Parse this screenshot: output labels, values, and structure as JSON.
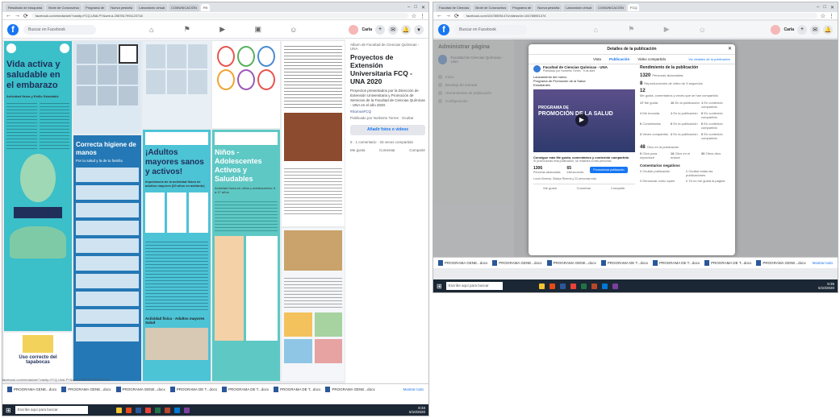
{
  "left": {
    "tabs": [
      "Resultado de búsqueda",
      "Brote de Coronavirus",
      "Programa de",
      "Nueva pestaña",
      "Laboratorio virtual",
      "COMUNICACIÓN",
      "FB"
    ],
    "url": "facebook.com/media/set/?vanity=FCQ.UNA.PY&set=a.2557817991123718",
    "fb": {
      "search_placeholder": "Buscar en Facebook",
      "user": "Carla"
    },
    "posters": {
      "p1_title": "Vida activa y saludable en el embarazo",
      "p1_sub": "Actividad física y Estilo Saludable",
      "p2_title": "Correcta higiene de manos",
      "p2_sub": "Por tu salud y la de tu familia",
      "p3_title": "¡Adultos mayores sanos y activos!",
      "p3_sub": "Importancia de la actividad física en adultos mayores (60 años en adelante)",
      "p4_title": "Niños - Adolescentes Activos y Saludables",
      "p4_sub": "Actividad física en niños y adolescentes: 5 a 17 años",
      "p3_foot": "Actividad física · Adultos mayores Salud",
      "p6_title": "Uso correcto del tapabocas"
    },
    "album": {
      "author": "Album de Facultad de Ciencias Químicas - UNA",
      "title": "Proyectos de Extensión Universitaria FCQ - UNA 2020",
      "desc": "Proyectos presentados por la Dirección de Extensión Universitaria y Promoción de Servicios de la Facultad de Ciencias Químicas - UNA en el año 2020.",
      "tag": "#SomosFCQ",
      "meta": "Publicado por Norberto Torres · Ocultar",
      "btn": "Añadir fotos o videos",
      "reactions": "5 · 1 comentario · 33 veces compartido",
      "actions": [
        "Me gusta",
        "Comentar",
        "Compartir"
      ]
    },
    "downloads": [
      "PROGRAMA GENE...docx",
      "PROGRAMA GENE...docx",
      "PROGRAMA GENE...docx",
      "PROGRAMA DE T...docx",
      "PROGRAMA DE T...docx",
      "PROGRAMA DE T...docx",
      "PROGRAMA GENE...docx"
    ],
    "show_all": "Mostrar todo",
    "search_task": "Escribe aquí para buscar",
    "time": "8:33",
    "date": "5/10/2020"
  },
  "right": {
    "tabs": [
      "Facultad de Ciencias",
      "Brote de Coronavirus",
      "Programa de",
      "Nueva pestaña",
      "Laboratorio virtual",
      "COMUNICACIÓN",
      "FCQ"
    ],
    "url": "facebook.com/104785951474/videos/vb.104785951474",
    "fb": {
      "search_placeholder": "Buscar en Facebook",
      "user": "Carla"
    },
    "side_title": "Administrar página",
    "page_name": "Facultad de Ciencias Químicas - UNA",
    "side_items": [
      "Inicio",
      "Bandeja de entrada",
      "Herramientas de publicación",
      "Configuración"
    ],
    "modal": {
      "header": "Detalles de la publicación",
      "tabs": [
        "Vista",
        "Publicación",
        "Video compartido"
      ],
      "link": "Ver detalles de la publicación",
      "page": "Facultad de Ciencias Químicas - UNA",
      "posted": "Publicado por Norberto Torres · 5 de abril",
      "l1": "Lanzamiento del nuevo",
      "l2": "Programa de Promoción de la Salud",
      "l3": "Estudiantes",
      "video_t1": "PROGRAMA DE",
      "video_t2": "PROMOCIÓN DE LA SALUD",
      "cta": "Consigue más Me gusta, comentarios y contenido compartido",
      "cta_sub": "Si promocionas esta publicación, se mostrará a más personas",
      "n1": "1306",
      "n1l": "Personas alcanzadas",
      "n2": "65",
      "n2l": "Interacciones",
      "promote": "Promocionar publicación",
      "reactions": "Lucía Gimena, Gladys Riveros y 22 personas más",
      "actions": [
        "Me gusta",
        "Comentar",
        "Compartir"
      ]
    },
    "stats": {
      "title": "Rendimiento de la publicación",
      "reach": "1320",
      "reach_l": "Personas alcanzadas",
      "views": "8",
      "views_l": "Reproducciones de video de 3 segundos",
      "clicks": "12",
      "clicks_l": "Me gusta, comentarios y veces que se han compartido",
      "rows": [
        [
          "17",
          "Me gusta",
          "16",
          "En la publicación",
          "1",
          "En contenido compartido"
        ],
        [
          "1",
          "Me encanta",
          "1",
          "En la publicación",
          "0",
          "En contenido compartido"
        ],
        [
          "0",
          "Comentarios",
          "0",
          "En la publicación",
          "0",
          "En contenido compartido"
        ],
        [
          "2",
          "Veces compartido",
          "2",
          "En la publicación",
          "0",
          "En contenido compartido"
        ]
      ],
      "clicks2": "48",
      "clicks2_l": "Clics en la publicación",
      "c_row": [
        "0",
        "Clics para reproducir",
        "18",
        "Clics en el enlace",
        "30",
        "Otros clics"
      ],
      "neg": "Comentarios negativos",
      "neg1": "0 Ocultar publicación",
      "neg2": "0 Ocultar todas las publicaciones",
      "neg3": "0 Denunciar como spam",
      "neg4": "0 Ya no me gusta la página"
    },
    "downloads": [
      "PROGRAMA GENE...docx",
      "PROGRAMA GENE...docx",
      "PROGRAMA GENE...docx",
      "PROGRAMA DE T...docx",
      "PROGRAMA DE T...docx",
      "PROGRAMA DE T...docx",
      "PROGRAMA GENE...docx"
    ],
    "show_all": "Mostrar todo",
    "search_task": "Escribe aquí para buscar",
    "time": "8:35",
    "date": "5/10/2020"
  },
  "colors": {
    "fb_blue": "#1877f2",
    "teal_poster": "#35b5c8",
    "navy": "#1f2f5a",
    "taskbar": "#1b2734"
  }
}
